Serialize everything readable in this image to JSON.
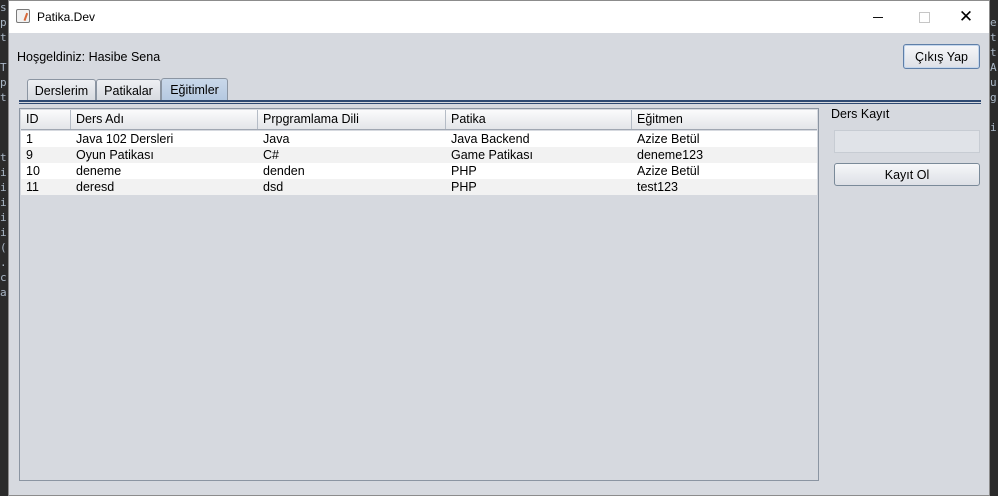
{
  "background_code": {
    "left": [
      "s",
      "p",
      "t",
      "",
      "T",
      "p",
      "t",
      "",
      "",
      "",
      "t",
      "i",
      "i",
      "i",
      "i",
      "i",
      "(",
      ".",
      "c",
      "a"
    ],
    "right": [
      "",
      "e",
      "t",
      "t",
      "A",
      "u",
      "g",
      "",
      "i"
    ]
  },
  "window": {
    "title": "Patika.Dev",
    "controls": {
      "minimize": "minimize-icon",
      "maximize": "maximize-icon",
      "close": "✕"
    }
  },
  "header": {
    "welcome": "Hoşgeldiniz: Hasibe Sena",
    "logout_label": "Çıkış Yap"
  },
  "tabs": [
    {
      "label": "Derslerim",
      "active": false
    },
    {
      "label": "Patikalar",
      "active": false
    },
    {
      "label": "Eğitimler",
      "active": true
    }
  ],
  "table": {
    "columns": [
      "ID",
      "Ders Adı",
      "Prpgramlama Dili",
      "Patika",
      "Eğitmen"
    ],
    "rows": [
      [
        "1",
        "Java 102 Dersleri",
        "Java",
        "Java Backend",
        "Azize Betül"
      ],
      [
        "9",
        "Oyun Patikası",
        "C#",
        "Game Patikası",
        "deneme123"
      ],
      [
        "10",
        "deneme",
        "denden",
        "PHP",
        "Azize Betül"
      ],
      [
        "11",
        "deresd",
        "dsd",
        "PHP",
        "test123"
      ]
    ]
  },
  "side_panel": {
    "label": "Ders Kayıt",
    "input_value": "",
    "register_label": "Kayıt Ol"
  },
  "colors": {
    "window_bg": "#d6d9df",
    "tab_active": "#b4c8e0",
    "tab_rule": "#2f4a72"
  }
}
